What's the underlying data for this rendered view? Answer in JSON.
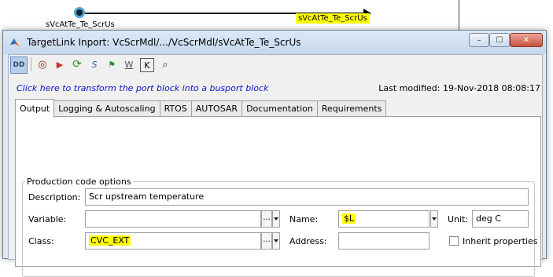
{
  "canvas": {
    "inport_label": "sVcAtTe_Te_ScrUs",
    "signal_label": "sVcAtTe_Te_ScrUs",
    "highlight_color": "#ffff00"
  },
  "window": {
    "title": "TargetLink Inport: VcScrMdl/.../VcScrMdl/sVcAtTe_Te_ScrUs",
    "app_icon": "matlab-icon",
    "close_glyph": "✕",
    "min_glyph": "–",
    "max_glyph": "☐"
  },
  "toolbar": {
    "icons": [
      "dd-icon",
      "zoom-icon",
      "run-icon",
      "refresh-icon",
      "script-icon",
      "flag-icon",
      "w-icon",
      "k-icon",
      "find-icon"
    ],
    "glyphs": [
      "DD",
      "◎",
      "▶",
      "⟳",
      "S",
      "⚑",
      "W",
      "K",
      "⌕"
    ]
  },
  "busport_link": "Click here to transform the port block into a busport block",
  "last_modified": "Last modified: 19-Nov-2018 08:08:17",
  "tabs": [
    "Output",
    "Logging & Autoscaling",
    "RTOS",
    "AUTOSAR",
    "Documentation",
    "Requirements"
  ],
  "active_tab": "Output",
  "production": {
    "group_label": "Production code options",
    "description_label": "Description:",
    "description_value": "Scr upstream temperature",
    "variable_label": "Variable:",
    "variable_value": "",
    "name_label": "Name:",
    "name_value": "$L",
    "unit_label": "Unit:",
    "unit_value": "deg C",
    "class_label": "Class:",
    "class_value": "CVC_EXT",
    "address_label": "Address:",
    "address_value": "",
    "inherit_label": "Inherit properties",
    "dots": "..."
  }
}
